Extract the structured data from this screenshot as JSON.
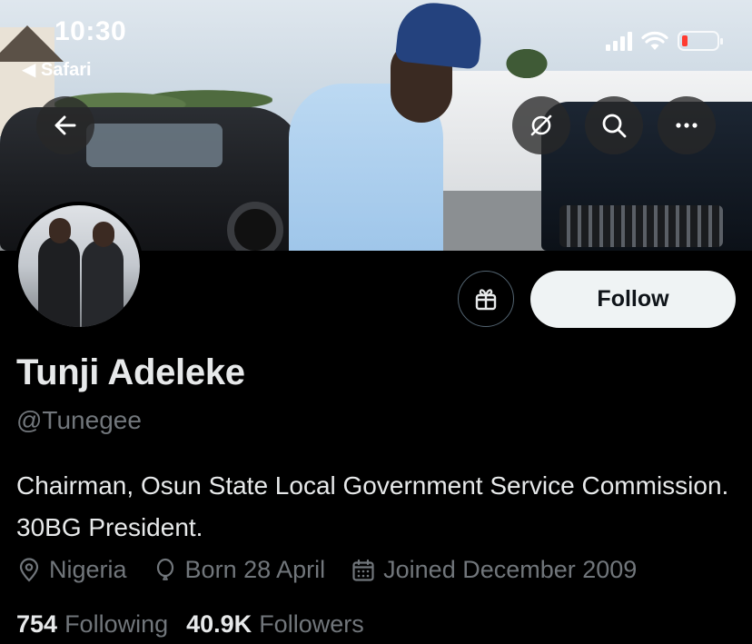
{
  "status_bar": {
    "time": "10:30",
    "back_app": "Safari",
    "battery_color": "#ff3b30"
  },
  "banner": {
    "icons": [
      "back-arrow-icon",
      "link-off-icon",
      "search-icon",
      "more-icon"
    ]
  },
  "actions": {
    "gift_icon": "gift-icon",
    "follow_label": "Follow"
  },
  "profile": {
    "name": "Tunji Adeleke",
    "handle": "@Tunegee",
    "bio": "Chairman, Osun State Local Government Service Commission. 30BG President.",
    "location": "Nigeria",
    "born": "Born 28 April",
    "joined": "Joined December 2009",
    "following_count": "754",
    "following_label": "Following",
    "followers_count": "40.9K",
    "followers_label": "Followers"
  },
  "colors": {
    "background": "#000000",
    "text_primary": "#e7e9ea",
    "text_secondary": "#71767b",
    "follow_bg": "#eff3f4"
  }
}
